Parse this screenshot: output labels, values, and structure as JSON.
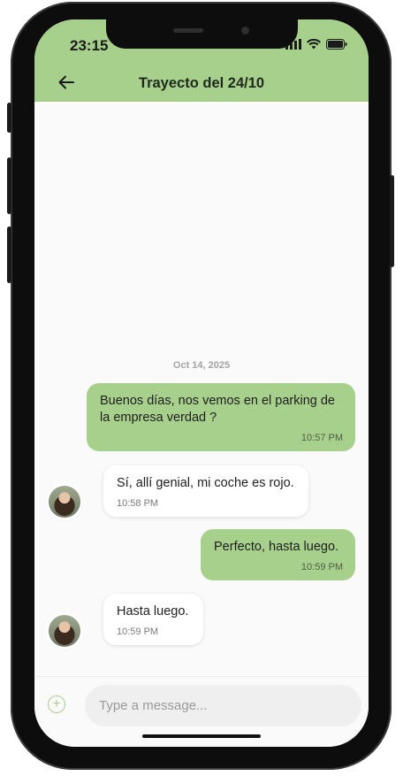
{
  "status_bar": {
    "time": "23:15"
  },
  "header": {
    "title": "Trayecto del 24/10",
    "back_icon": "arrow-left-icon"
  },
  "chat": {
    "date_separator": "Oct 14, 2025",
    "messages": [
      {
        "direction": "out",
        "text": "Buenos días, nos vemos en el parking de la empresa verdad ?",
        "time": "10:57 PM"
      },
      {
        "direction": "in",
        "text": "Sí, allí genial, mi coche es rojo.",
        "time": "10:58 PM"
      },
      {
        "direction": "out",
        "text": "Perfecto, hasta luego.",
        "time": "10:59 PM"
      },
      {
        "direction": "in",
        "text": "Hasta luego.",
        "time": "10:59 PM"
      }
    ]
  },
  "composer": {
    "placeholder": "Type a message...",
    "value": "",
    "add_icon": "plus-circle-icon"
  },
  "colors": {
    "accent": "#a8d08d",
    "background": "#fafafa",
    "incoming_bubble": "#ffffff"
  }
}
